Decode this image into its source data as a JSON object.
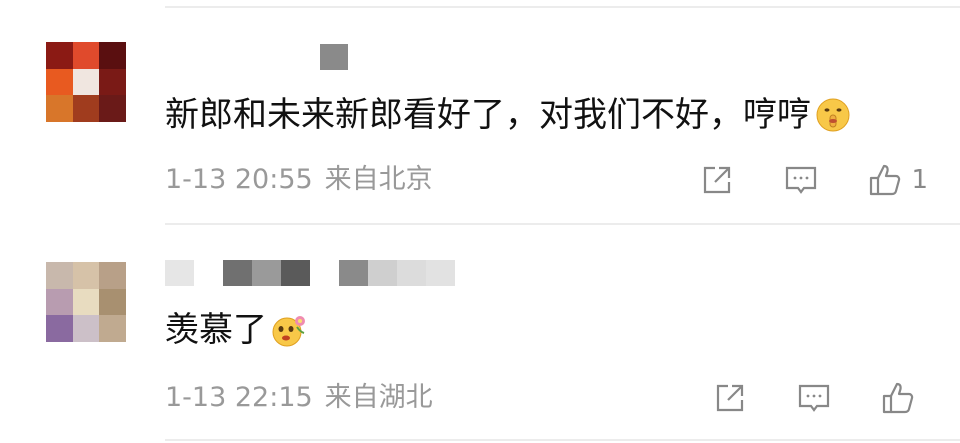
{
  "comments": [
    {
      "text": "新郎和未来新郎看好了，对我们不好，哼哼",
      "emoji": "shush-emoji",
      "time": "1-13 20:55",
      "location": "来自北京",
      "like_count": "1",
      "avatar_colors": [
        "#8b1a14",
        "#e04a2c",
        "#5a0f10",
        "#e85a20",
        "#f0e6e0",
        "#7a1a16",
        "#d8762a",
        "#a03c1e",
        "#6a1a18"
      ],
      "name_colors": [
        "#8a8a8a"
      ]
    },
    {
      "text": "羡慕了",
      "emoji": "flower-face-emoji",
      "time": "1-13 22:15",
      "location": "来自湖北",
      "like_count": "",
      "avatar_colors": [
        "#c8b8ac",
        "#d6c2a8",
        "#b8a088",
        "#b89cb0",
        "#e8dcc0",
        "#a89070",
        "#8a6aa0",
        "#ccc0c8",
        "#c0aa90"
      ],
      "name_colors": [
        "#e6e6e6",
        "#ffffff",
        "#707070",
        "#9a9a9a",
        "#5a5a5a",
        "#ffffff",
        "#8a8a8a",
        "#cfcfcf",
        "#dcdcdc",
        "#e2e2e2"
      ]
    }
  ]
}
